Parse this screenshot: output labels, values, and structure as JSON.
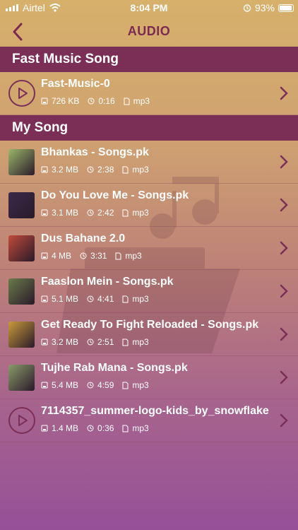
{
  "status": {
    "carrier": "Airtel",
    "time": "8:04 PM",
    "battery": "93%"
  },
  "nav": {
    "title": "AUDIO"
  },
  "sections": [
    {
      "title": "Fast Music Song"
    },
    {
      "title": "My Song"
    }
  ],
  "fast_items": [
    {
      "title": "Fast-Music-0",
      "size": "726 KB",
      "duration": "0:16",
      "format": "mp3",
      "icon": "play-icon"
    }
  ],
  "songs": [
    {
      "title": "Bhankas - Songs.pk",
      "size": "3.2 MB",
      "duration": "2:38",
      "format": "mp3",
      "thumb_color": "#9bb66a"
    },
    {
      "title": "Do You Love Me - Songs.pk",
      "size": "3.1 MB",
      "duration": "2:42",
      "format": "mp3",
      "thumb_color": "#3b2a4a"
    },
    {
      "title": "Dus Bahane 2.0",
      "size": "4 MB",
      "duration": "3:31",
      "format": "mp3",
      "thumb_color": "#c04a3a"
    },
    {
      "title": "Faaslon Mein - Songs.pk",
      "size": "5.1 MB",
      "duration": "4:41",
      "format": "mp3",
      "thumb_color": "#6a7a4a"
    },
    {
      "title": "Get Ready To Fight Reloaded - Songs.pk",
      "size": "3.2 MB",
      "duration": "2:51",
      "format": "mp3",
      "thumb_color": "#c99a3a"
    },
    {
      "title": "Tujhe Rab Mana - Songs.pk",
      "size": "5.4 MB",
      "duration": "4:59",
      "format": "mp3",
      "thumb_color": "#8a9a6a"
    },
    {
      "title": "7114357_summer-logo-kids_by_snowflake",
      "size": "1.4 MB",
      "duration": "0:36",
      "format": "mp3",
      "icon": "play-icon"
    }
  ],
  "colors": {
    "accent": "#7b2f57",
    "header_bg": "#7b2f57"
  }
}
